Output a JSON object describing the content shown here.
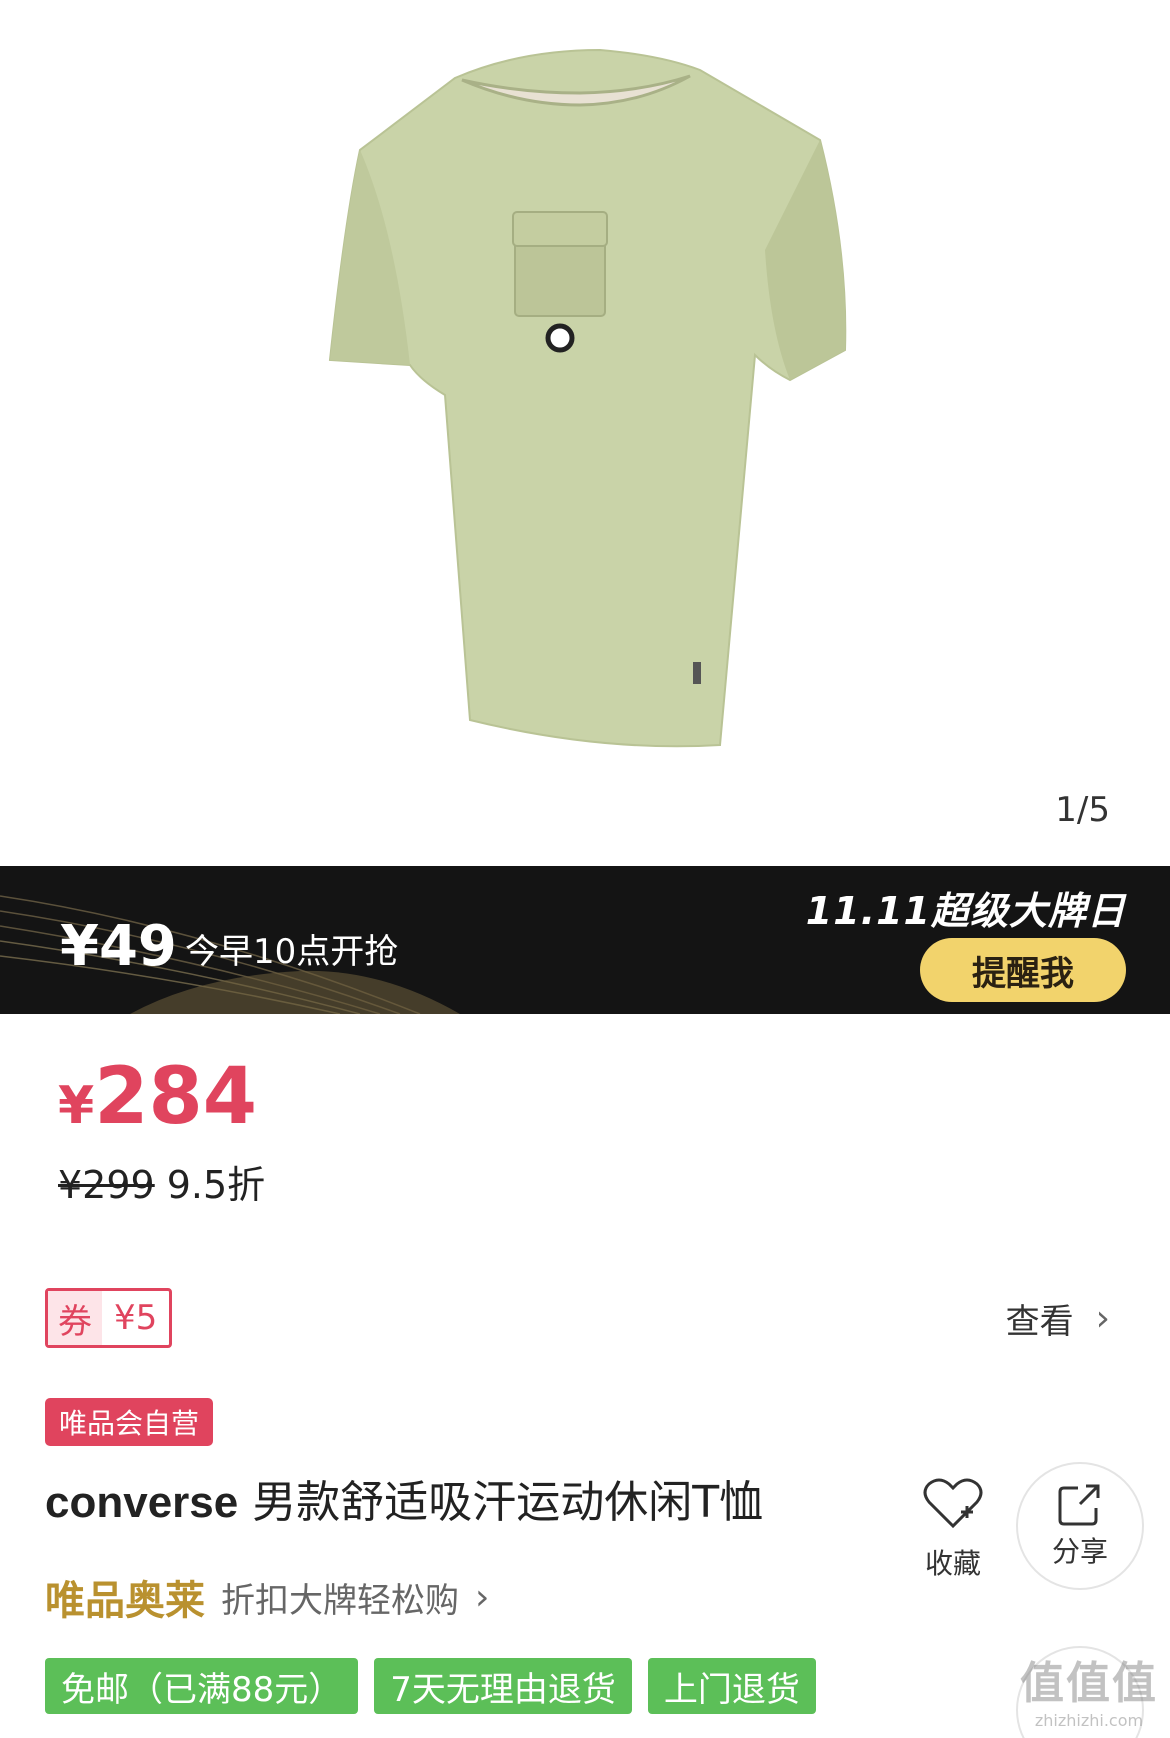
{
  "gallery": {
    "page_counter": "1/5",
    "image_alt": "converse 男款舒适吸汗运动休闲T恤"
  },
  "promo_bar": {
    "price": "¥49",
    "sale_text": "今早10点开抢",
    "brand_day": "11.11超级大牌日",
    "remind_label": "提醒我"
  },
  "price": {
    "currency": "¥",
    "current": "284",
    "original": "¥299",
    "discount": "9.5折"
  },
  "coupon": {
    "label": "券",
    "amount": "¥5",
    "view_label": "查看"
  },
  "product": {
    "self_operated_badge": "唯品会自营",
    "brand": "converse",
    "title": "男款舒适吸汗运动休闲T恤"
  },
  "actions": {
    "favorite_label": "收藏",
    "share_label": "分享"
  },
  "outlet": {
    "logo": "唯品奥莱",
    "slogan": "折扣大牌轻松购"
  },
  "service_tags": [
    "免邮（已满88元）",
    "7天无理由退货",
    "上门退货"
  ],
  "watermark": {
    "main": "值值值",
    "sub": "zhizhizhi.com"
  },
  "colors": {
    "price_red": "#e0445e",
    "promo_bg": "#141414",
    "remind_yellow": "#f2d36c",
    "service_green": "#5cbf58",
    "outlet_gold": "#b9912f"
  }
}
